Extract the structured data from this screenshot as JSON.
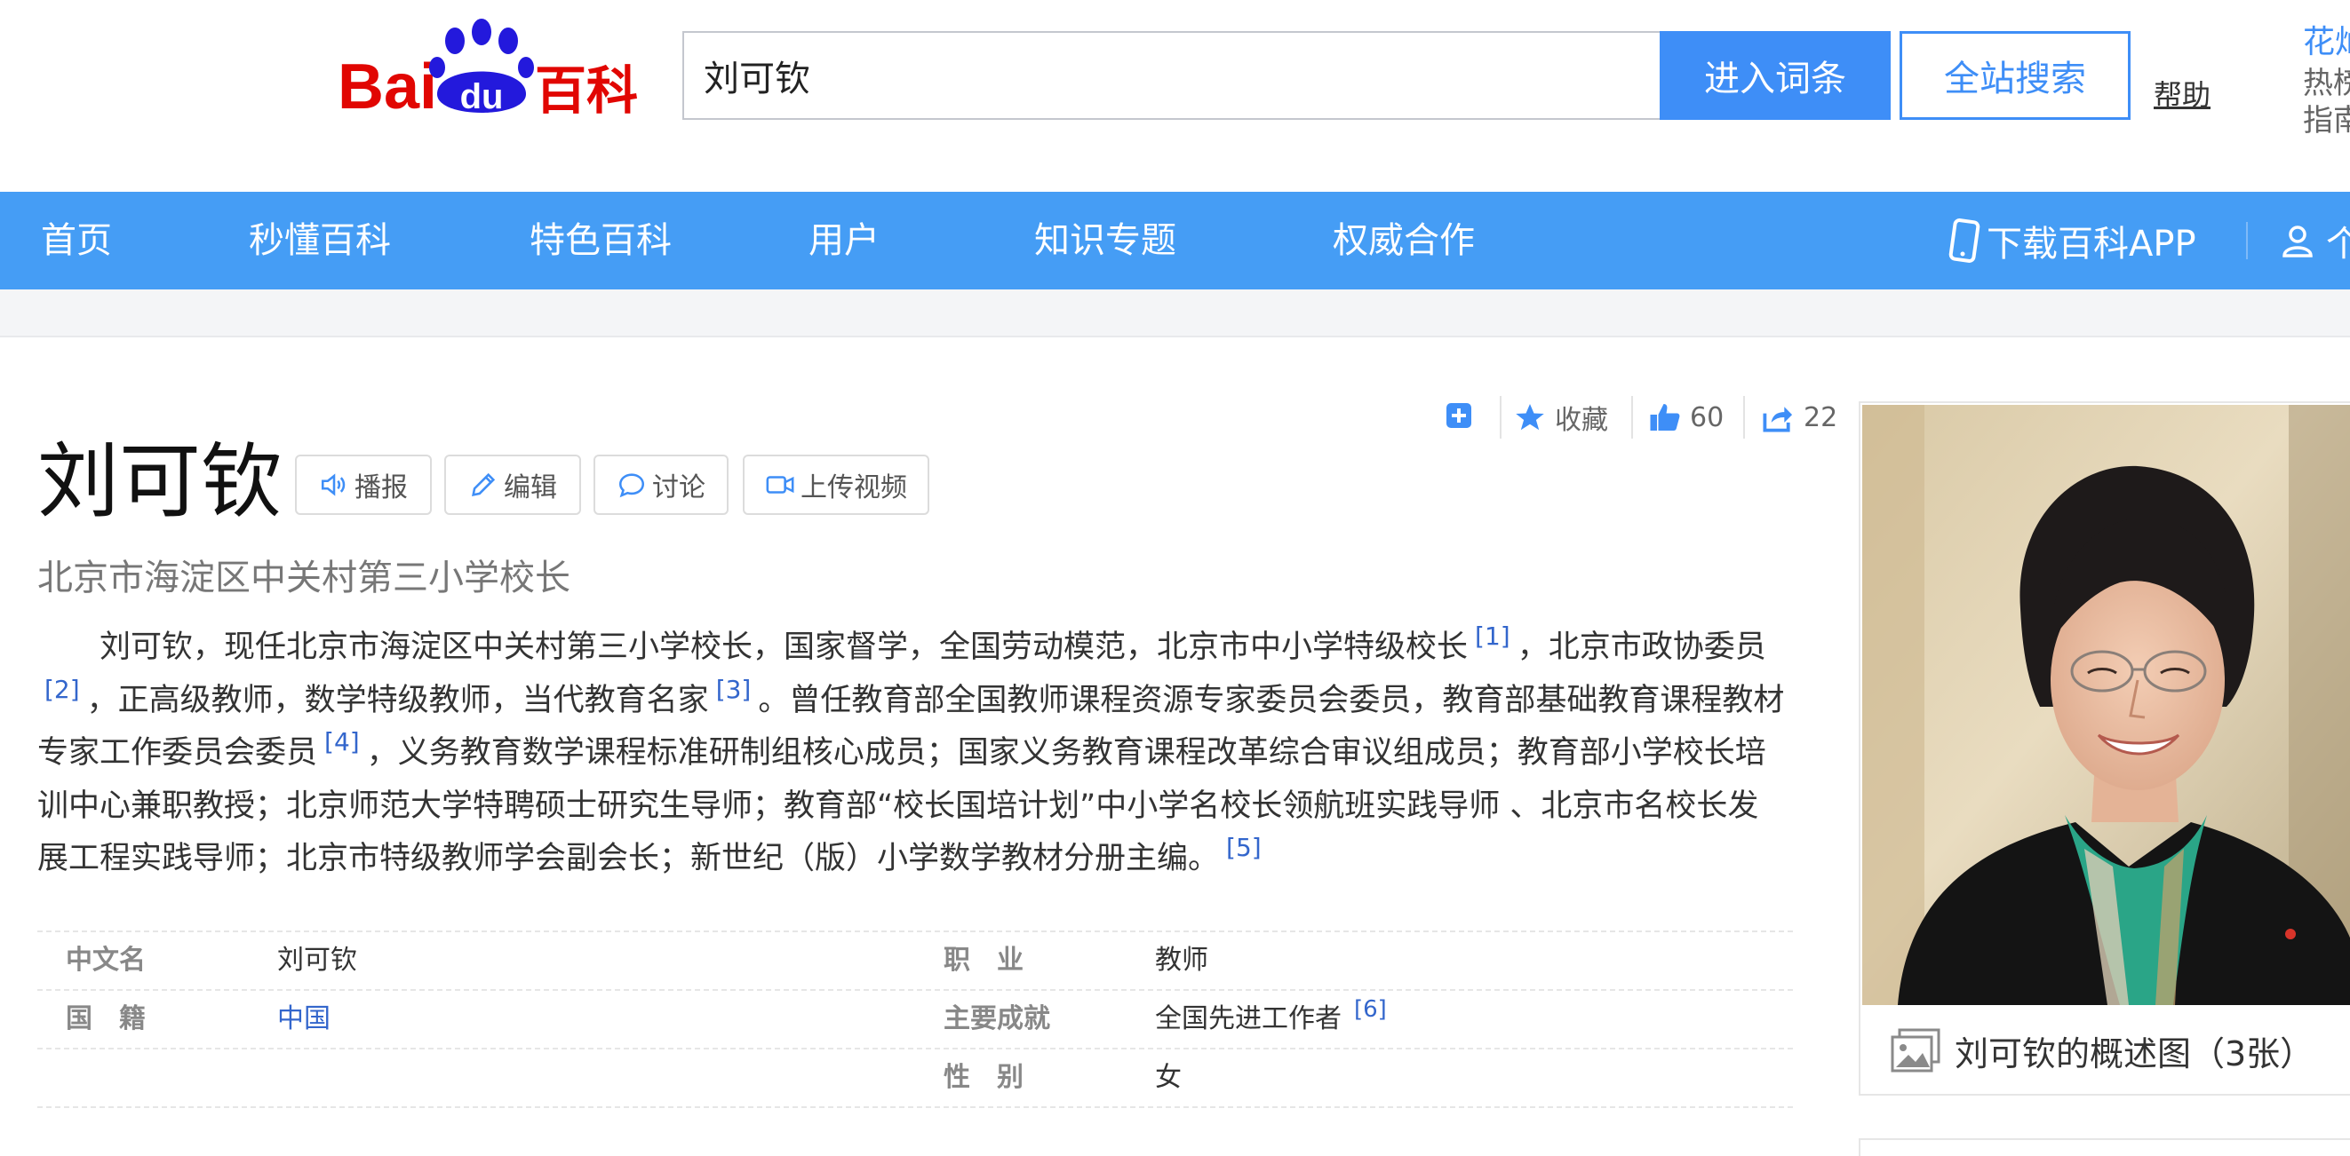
{
  "logo": {
    "left_text": "Bai",
    "paw_text": "du",
    "right_text": "百科"
  },
  "search": {
    "value": "刘可钦",
    "enter_label": "进入词条",
    "site_search_label": "全站搜索",
    "help_label": "帮助"
  },
  "top_right": {
    "line1": "花灿",
    "line2": "热榜",
    "line3": "指南"
  },
  "nav": {
    "items": [
      "首页",
      "秒懂百科",
      "特色百科",
      "用户",
      "知识专题",
      "权威合作"
    ],
    "download_app": "下载百科APP",
    "user_label": "个"
  },
  "entry": {
    "title": "刘可钦",
    "buttons": {
      "broadcast": "播报",
      "edit": "编辑",
      "discuss": "讨论",
      "upload_video": "上传视频"
    },
    "subtitle": "北京市海淀区中关村第三小学校长",
    "actions": {
      "favorite_label": "收藏",
      "like_count": "60",
      "share_count": "22"
    },
    "summary": {
      "p1": "刘可钦，现任北京市海淀区中关村第三小学校长，国家督学，全国劳动模范，北京市中小学特级校长",
      "r1": "[1]",
      "p2": "，北京市政协委员",
      "r2": "[2]",
      "p3": "，正高级教师，数学特级教师，当代教育名家",
      "r3": "[3]",
      "p4": "。曾任教育部全国教师课程资源专家委员会委员，教育部基础教育课程教材专家工作委员会委员",
      "r4": "[4]",
      "p5": "，义务教育数学课程标准研制组核心成员；国家义务教育课程改革综合审议组成员；教育部小学校长培训中心兼职教授；北京师范大学特聘硕士研究生导师；教育部“校长国培计划”中小学名校长领航班实践导师 、北京市名校长发展工程实践导师；北京市特级教师学会副会长；新世纪（版）小学数学教材分册主编。",
      "r5": "[5]"
    },
    "info": {
      "chinese_name_label": "中文名",
      "chinese_name_value": "刘可钦",
      "occupation_label": "职　业",
      "occupation_value": "教师",
      "nationality_label": "国　籍",
      "nationality_value": "中国",
      "achievement_label": "主要成就",
      "achievement_value": "全国先进工作者",
      "achievement_ref": "[6]",
      "gender_label": "性　别",
      "gender_value": "女"
    },
    "photo_caption": "刘可钦的概述图（3张）"
  },
  "colors": {
    "brand_blue": "#459df5",
    "button_blue": "#3e8ef7",
    "logo_red": "#e10602",
    "logo_blue": "#2319dc",
    "link_blue": "#3366cc"
  }
}
